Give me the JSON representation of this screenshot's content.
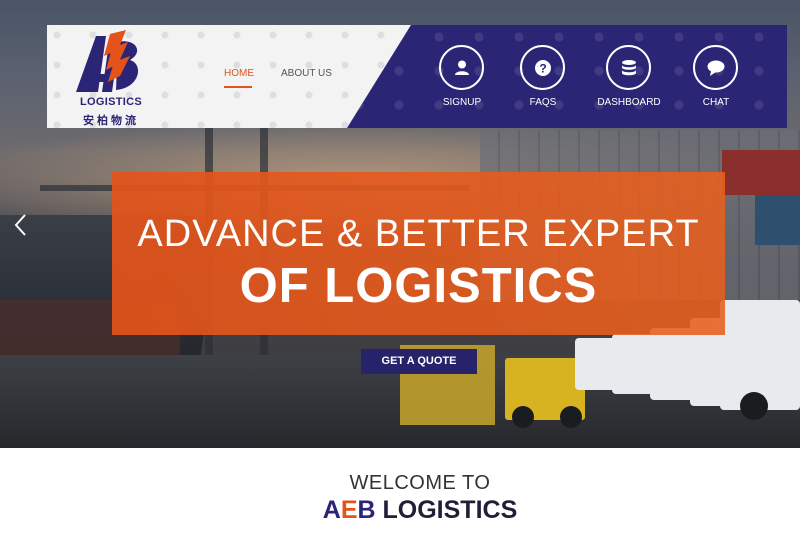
{
  "header": {
    "logo": {
      "mark": "AB",
      "name": "LOGISTICS",
      "chinese": "安柏物流"
    },
    "nav_text": [
      {
        "label": "HOME",
        "active": true
      },
      {
        "label": "ABOUT US",
        "active": false
      }
    ],
    "nav_icons": [
      {
        "label": "SIGNUP",
        "icon": "user-icon"
      },
      {
        "label": "FAQS",
        "icon": "question-icon"
      },
      {
        "label": "DASHBOARD",
        "icon": "database-icon"
      },
      {
        "label": "CHAT",
        "icon": "chat-bubble-icon"
      }
    ]
  },
  "hero": {
    "line1": "ADVANCE & BETTER EXPERT",
    "line2": "OF LOGISTICS",
    "cta": "GET A QUOTE",
    "prev_icon": "chevron-left-icon"
  },
  "welcome": {
    "line1": "WELCOME TO",
    "brand_a": "A",
    "brand_e": "E",
    "brand_b": "B",
    "brand_rest": " LOGISTICS"
  },
  "colors": {
    "navy": "#2b2575",
    "orange": "#e3531a",
    "white": "#ffffff"
  }
}
